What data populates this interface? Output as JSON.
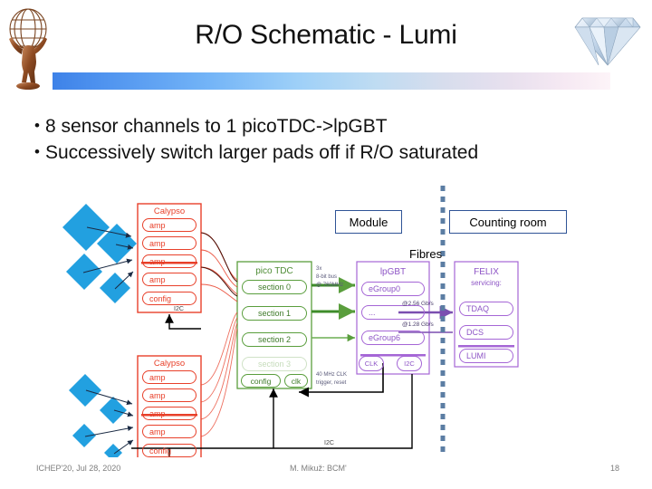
{
  "header": {
    "title": "R/O Schematic - Lumi",
    "left_logo": "atlas-statue-logo",
    "right_logo": "diamond-gem-logo"
  },
  "bullets": [
    {
      "marker": "•",
      "text": "8 sensor channels to 1 picoTDC->lpGBT"
    },
    {
      "marker": "•",
      "text": "Successively switch larger pads off if R/O saturated"
    }
  ],
  "diagram": {
    "region_labels": {
      "module": "Module",
      "counting_room": "Counting room",
      "fibres": "Fibres"
    },
    "calypso_top": {
      "title": "Calypso",
      "rows": [
        "amp",
        "amp",
        "amp",
        "amp",
        "config"
      ],
      "pc_label": "I2C"
    },
    "calypso_bottom": {
      "title": "Calypso",
      "rows": [
        "amp",
        "amp",
        "amp",
        "amp",
        "config"
      ],
      "pc_label": "I2C"
    },
    "pico_tdc": {
      "title": "pico TDC",
      "sections": [
        "section 0",
        "section 1",
        "section 2",
        "section 3"
      ],
      "bottom_cells": [
        "config",
        "clk"
      ],
      "link_note": "3x\n8-bit bus\n@ 760MHz",
      "clk_note": "40 MHz CLK\ntrigger, reset"
    },
    "lpgbt": {
      "title": "lpGBT",
      "groups": [
        "eGroup0",
        "...",
        "eGroup6"
      ],
      "bottom_cells": [
        "CLK",
        "I2C"
      ]
    },
    "felix": {
      "title": "FELIX",
      "subtitle": "servicing:",
      "rows": [
        "TDAQ",
        "DCS",
        "LUMI"
      ]
    },
    "fibre_rates": {
      "uplink": "@2.56 Gb/s",
      "downlink": "@1.28 Gb/s"
    },
    "bottom_bus_label": "I2C",
    "sensor_pads": "blue-diamond-sensor-pads",
    "colors": {
      "calypso": "#e8402a",
      "pico_tdc": "#5a9e3d",
      "lpgbt": "#a566d6",
      "felix": "#a566d6",
      "sensor_pad": "#22a0e0",
      "fibre_line": "#5b7da3",
      "label_border": "#2f5496"
    }
  },
  "footer": {
    "left": "ICHEP'20, Jul 28, 2020",
    "center": "M. Mikuž: BCM'",
    "right": "18"
  }
}
